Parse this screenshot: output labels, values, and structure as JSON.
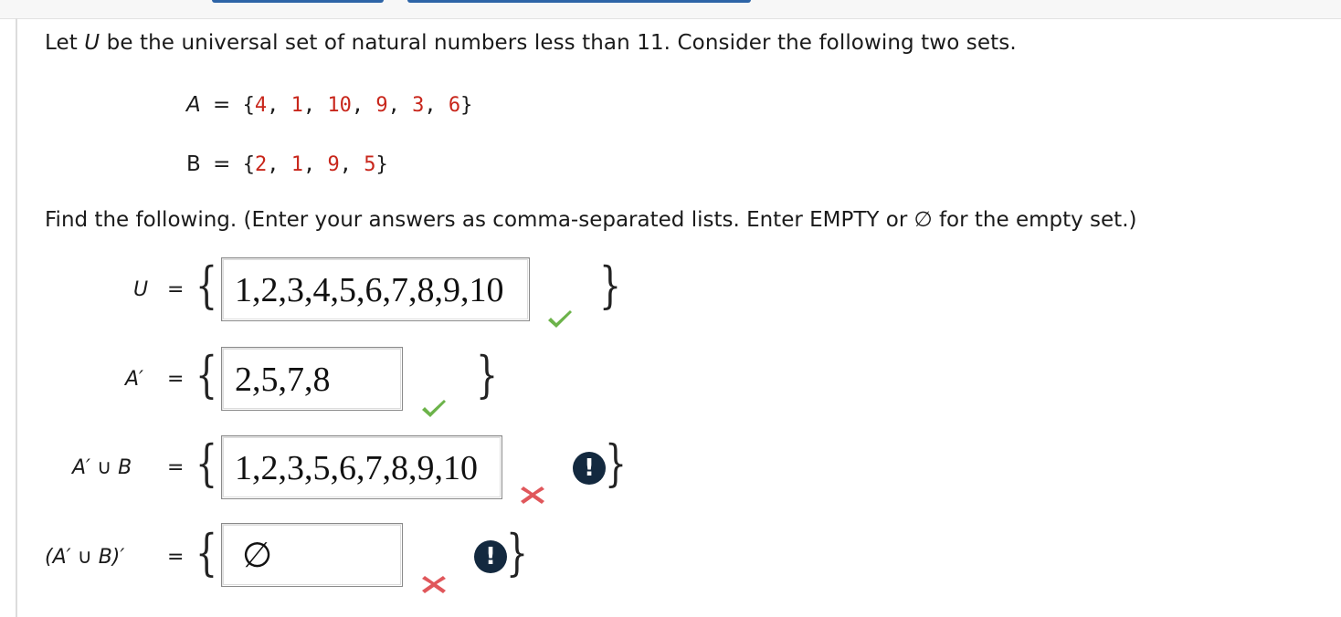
{
  "intro_text_1": "Let ",
  "intro_var": "U",
  "intro_text_2": " be the universal set of natural numbers less than 11. Consider the following two sets.",
  "set_a": {
    "name": "A",
    "eq": "=",
    "open": "{",
    "close": "}",
    "sep": ", ",
    "elements": [
      "4",
      "1",
      "10",
      "9",
      "3",
      "6"
    ]
  },
  "set_b": {
    "name": "B",
    "eq": "=",
    "open": "{",
    "close": "}",
    "sep": ", ",
    "elements": [
      "2",
      "1",
      "9",
      "5"
    ]
  },
  "instructions": "Find the following. (Enter your answers as comma-separated lists. Enter EMPTY or ∅ for the empty set.)",
  "questions": [
    {
      "label": "U",
      "eq": "=",
      "open_brace": "{",
      "close_brace": "}",
      "answer": "1,2,3,4,5,6,7,8,9,10",
      "status": "correct",
      "mark_icon": "checkmark-icon"
    },
    {
      "label": "A′",
      "eq": "=",
      "open_brace": "{",
      "close_brace": "}",
      "answer": "2,5,7,8",
      "status": "correct",
      "mark_icon": "checkmark-icon"
    },
    {
      "label": "A′ ∪ B",
      "eq": "=",
      "open_brace": "{",
      "close_brace": "}",
      "answer": "1,2,3,5,6,7,8,9,10",
      "status": "incorrect",
      "mark_icon": "x-mark-icon",
      "alert": "!"
    },
    {
      "label": "(A′ ∪ B)′",
      "eq": "=",
      "open_brace": "{",
      "close_brace": "}",
      "answer": "∅",
      "status": "incorrect",
      "mark_icon": "x-mark-icon",
      "alert": "!"
    }
  ],
  "colors": {
    "element_red": "#c8261b",
    "check_green": "#6cb34a",
    "x_red": "#e0575b",
    "alert_bg": "#13293f"
  }
}
